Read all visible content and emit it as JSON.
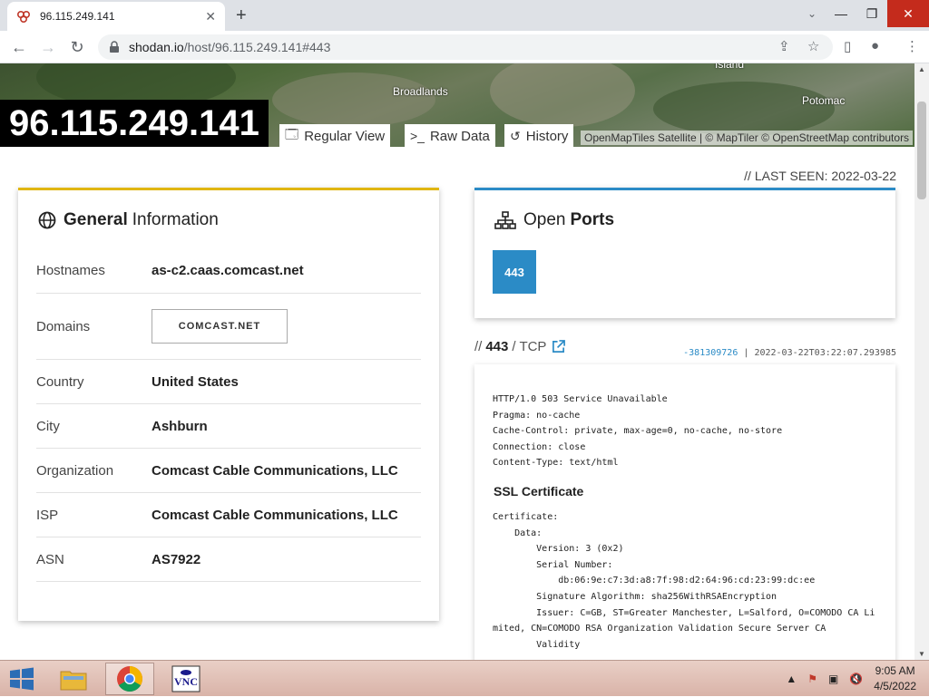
{
  "browser": {
    "tab_title": "96.115.249.141",
    "tab_close": "✕",
    "new_tab": "+",
    "url_host": "shodan.io",
    "url_path": "/host/96.115.249.141#443",
    "back": "←",
    "forward": "→",
    "reload": "↻",
    "window_controls": {
      "min": "—",
      "max": "❐",
      "close": "✕"
    }
  },
  "map": {
    "labels": [
      "Island",
      "Broadlands",
      "Potomac"
    ],
    "attribution": "OpenMapTiles Satellite | © MapTiler © OpenStreetMap contributors"
  },
  "host": {
    "ip": "96.115.249.141",
    "view_tabs": [
      {
        "label": "Regular View",
        "icon": "window-icon"
      },
      {
        "label": "Raw Data",
        "icon": "terminal-icon"
      },
      {
        "label": "History",
        "icon": "history-icon"
      }
    ],
    "last_seen": "// LAST SEEN: 2022-03-22"
  },
  "general": {
    "title_bold": "General",
    "title_light": "Information",
    "rows": [
      {
        "key": "Hostnames",
        "value": "as-c2.caas.comcast.net"
      },
      {
        "key": "Domains",
        "value": "COMCAST.NET"
      },
      {
        "key": "Country",
        "value": "United States"
      },
      {
        "key": "City",
        "value": "Ashburn"
      },
      {
        "key": "Organization",
        "value": "Comcast Cable Communications, LLC"
      },
      {
        "key": "ISP",
        "value": "Comcast Cable Communications, LLC"
      },
      {
        "key": "ASN",
        "value": "AS7922"
      }
    ]
  },
  "ports": {
    "title_light": "Open",
    "title_bold": "Ports",
    "list": [
      "443"
    ]
  },
  "service": {
    "prefix": "//",
    "port": "443",
    "proto": "/ TCP",
    "hash": "-381309726",
    "separator": "|",
    "timestamp": "2022-03-22T03:22:07.293985",
    "http": "HTTP/1.0 503 Service Unavailable\nPragma: no-cache\nCache-Control: private, max-age=0, no-cache, no-store\nConnection: close\nContent-Type: text/html",
    "ssl_heading": "SSL Certificate",
    "cert": "Certificate:\n    Data:\n        Version: 3 (0x2)\n        Serial Number:\n            db:06:9e:c7:3d:a8:7f:98:d2:64:96:cd:23:99:dc:ee\n        Signature Algorithm: sha256WithRSAEncryption\n        Issuer: C=GB, ST=Greater Manchester, L=Salford, O=COMODO CA Li\nmited, CN=COMODO RSA Organization Validation Secure Server CA\n        Validity"
  },
  "taskbar": {
    "time": "9:05 AM",
    "date": "4/5/2022"
  },
  "colors": {
    "general_accent": "#e0b612",
    "ports_accent": "#2b8bc6",
    "port_chip": "#2b8bc6"
  }
}
